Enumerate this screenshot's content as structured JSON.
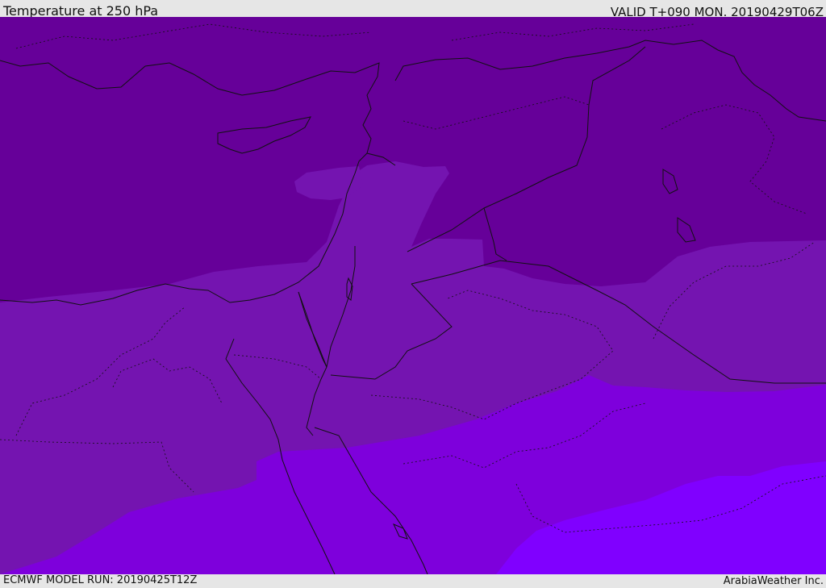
{
  "header": {
    "title": "Temperature at 250 hPa",
    "valid": "VALID T+090 MON. 20190429T06Z"
  },
  "footer": {
    "model_run": "ECMWF MODEL RUN: 20190425T12Z",
    "credit": "ArabiaWeather Inc."
  },
  "map": {
    "region": "Eastern Mediterranean / Middle East",
    "field": "temperature",
    "level": "250 hPa",
    "color_bands": [
      "#660099",
      "#7414b0",
      "#7e00dc",
      "#8000ff"
    ],
    "background": "#e6e6e6",
    "coast_color": "#111111"
  }
}
